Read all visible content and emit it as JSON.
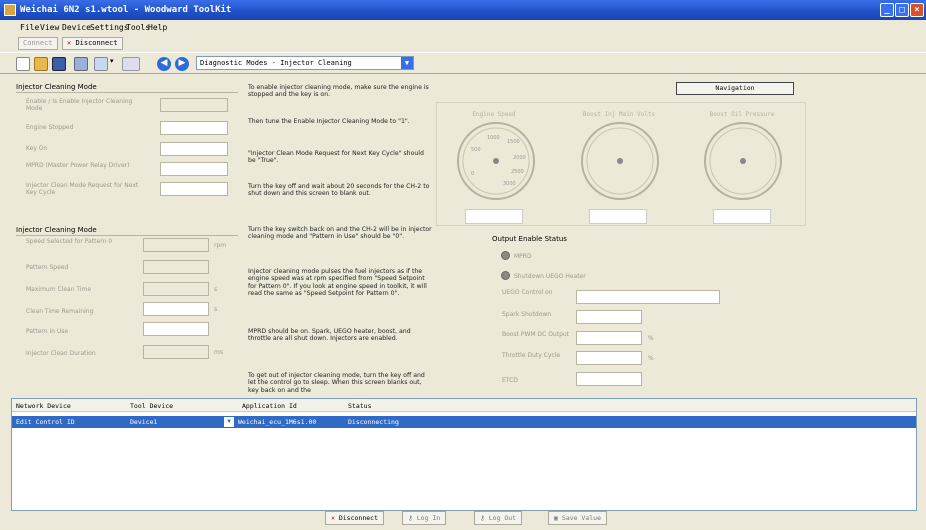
{
  "window": {
    "title": "Weichai 6N2 s1.wtool - Woodward ToolKit"
  },
  "menu": [
    "File",
    "View",
    "Device",
    "Settings",
    "Tools",
    "Help"
  ],
  "toolbar1": {
    "connect": "Connect",
    "disconnect": "Disconnect"
  },
  "toolbar2": {
    "page_select": "Diagnostic Modes - Injector Cleaning"
  },
  "section1": {
    "title": "Injector Cleaning Mode",
    "fields": [
      "Enable / Is Enable Injector Cleaning Mode",
      "Engine Stopped",
      "Key On",
      "MPRD (Master Power Relay Driver)",
      "Injector Clean Mode Request for Next Key Cycle"
    ]
  },
  "section2": {
    "title": "Injector Cleaning Mode",
    "fields": [
      "Speed Selected for Pattern 0",
      "Pattern Speed",
      "Maximum Clean Time",
      "Clean Time Remaining",
      "Pattern in Use",
      "Injector Clean Duration"
    ],
    "units": [
      "rpm",
      "s",
      "s",
      "ms"
    ]
  },
  "instructions": [
    "To enable injector cleaning mode, make sure the engine is stopped and the key is on.",
    "Then tune the Enable Injector Cleaning Mode to \"1\".",
    "\"Injector Clean Mode Request for Next Key Cycle\" should be \"True\".",
    "Turn the key off and wait about 20 seconds for the CH-2 to shut down and this screen to blank out.",
    "Turn the key switch back on and the CH-2 will be in injector cleaning mode and \"Pattern in Use\" should be \"0\".",
    "Injector cleaning mode pulses the fuel injectors as if the engine speed was at rpm specified from \"Speed Setpoint for Pattern 0\". If you look at engine speed in toolkit, it will read the same as \"Speed Setpoint for Pattern 0\".",
    "MPRD should be on. Spark, UEGO heater, boost, and throttle are all shut down. Injectors are enabled.",
    "To get out of injector cleaning mode, turn the key off and let the control go to sleep. When this screen blanks out, key back on and the"
  ],
  "navigation": "Navigation",
  "gauges": [
    {
      "title": "Engine Speed",
      "ticks": [
        "1000",
        "1500",
        "2000",
        "2500",
        "3000",
        "500",
        "0"
      ]
    },
    {
      "title": "Boost Inj Main Volts"
    },
    {
      "title": "Boost Oil Pressure"
    }
  ],
  "output_status": {
    "title": "Output Enable Status",
    "radios": [
      "MPRD",
      "Shutdown UEGO Heater"
    ],
    "fields": [
      "UEGO Control on",
      "Spark Shutdown",
      "Boost PWM DC Output",
      "Throttle Duty Cycle",
      "ETCD"
    ],
    "units": [
      "%",
      "%"
    ]
  },
  "network_table": {
    "headers": [
      "Network Device",
      "Tool Device",
      "Application Id",
      "Status"
    ],
    "rows": [
      [
        "Edit Control ID",
        "Device1",
        "Weichai_ecu_1M6s1.00",
        "Disconnecting"
      ]
    ]
  },
  "bottom_buttons": [
    "Disconnect",
    "Log In",
    "Log Out",
    "Save Value"
  ]
}
